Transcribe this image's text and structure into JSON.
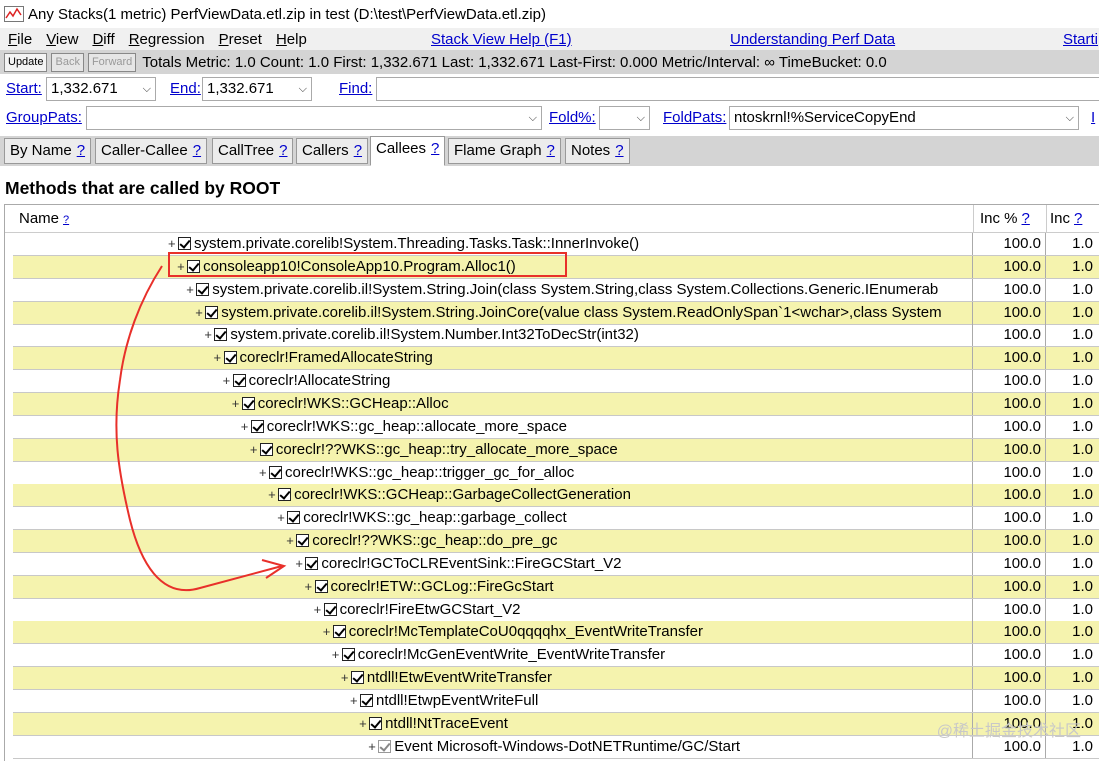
{
  "window": {
    "title": "Any Stacks(1 metric) PerfViewData.etl.zip in test (D:\\test\\PerfViewData.etl.zip)"
  },
  "menu": {
    "items": [
      {
        "u": "F",
        "rest": "ile"
      },
      {
        "u": "V",
        "rest": "iew"
      },
      {
        "u": "D",
        "rest": "iff"
      },
      {
        "u": "R",
        "rest": "egression"
      },
      {
        "u": "P",
        "rest": "reset"
      },
      {
        "u": "H",
        "rest": "elp"
      }
    ],
    "links": [
      "Stack View Help (F1)",
      "Understanding Perf Data",
      "Starti"
    ]
  },
  "status": {
    "update": "Update",
    "back": "Back",
    "forward": "Forward",
    "totals": "Totals Metric: 1.0  Count: 1.0  First: 1,332.671  Last: 1,332.671   Last-First: 0.000  Metric/Interval: ∞  TimeBucket: 0.0"
  },
  "range": {
    "start_label": "Start:",
    "start_value": "1,332.671",
    "end_label": "End:",
    "end_value": "1,332.671",
    "find_label": "Find:",
    "find_value": ""
  },
  "grouping": {
    "grouppats_label": "GroupPats:",
    "grouppats_value": "",
    "fold_label": "Fold%:",
    "fold_value": "",
    "foldpats_label": "FoldPats:",
    "foldpats_value": "ntoskrnl!%ServiceCopyEnd",
    "trailing_label": "I"
  },
  "tabs": [
    {
      "label": "By Name",
      "q": "?"
    },
    {
      "label": "Caller-Callee",
      "q": "?"
    },
    {
      "label": "CallTree",
      "q": "?"
    },
    {
      "label": "Callers",
      "q": "?"
    },
    {
      "label": "Callees",
      "q": "?"
    },
    {
      "label": "Flame Graph",
      "q": "?"
    },
    {
      "label": "Notes",
      "q": "?"
    }
  ],
  "heading": "Methods that are called by ROOT",
  "columns": {
    "name": "Name",
    "inc_pct": "Inc %",
    "inc": "Inc",
    "q": "?"
  },
  "rows": [
    {
      "name": "system.private.corelib!System.Threading.Tasks.Task::InnerInvoke()",
      "inc_pct": "100.0",
      "inc": "1.0"
    },
    {
      "name": "consoleapp10!ConsoleApp10.Program.Alloc1()",
      "inc_pct": "100.0",
      "inc": "1.0"
    },
    {
      "name": "system.private.corelib.il!System.String.Join(class System.String,class System.Collections.Generic.IEnumerab",
      "inc_pct": "100.0",
      "inc": "1.0"
    },
    {
      "name": "system.private.corelib.il!System.String.JoinCore(value class System.ReadOnlySpan`1<wchar>,class System",
      "inc_pct": "100.0",
      "inc": "1.0"
    },
    {
      "name": "system.private.corelib.il!System.Number.Int32ToDecStr(int32)",
      "inc_pct": "100.0",
      "inc": "1.0"
    },
    {
      "name": "coreclr!FramedAllocateString",
      "inc_pct": "100.0",
      "inc": "1.0"
    },
    {
      "name": "coreclr!AllocateString",
      "inc_pct": "100.0",
      "inc": "1.0"
    },
    {
      "name": "coreclr!WKS::GCHeap::Alloc",
      "inc_pct": "100.0",
      "inc": "1.0"
    },
    {
      "name": "coreclr!WKS::gc_heap::allocate_more_space",
      "inc_pct": "100.0",
      "inc": "1.0"
    },
    {
      "name": "coreclr!??WKS::gc_heap::try_allocate_more_space",
      "inc_pct": "100.0",
      "inc": "1.0"
    },
    {
      "name": "coreclr!WKS::gc_heap::trigger_gc_for_alloc",
      "inc_pct": "100.0",
      "inc": "1.0"
    },
    {
      "name": "coreclr!WKS::GCHeap::GarbageCollectGeneration",
      "inc_pct": "100.0",
      "inc": "1.0"
    },
    {
      "name": "coreclr!WKS::gc_heap::garbage_collect",
      "inc_pct": "100.0",
      "inc": "1.0"
    },
    {
      "name": "coreclr!??WKS::gc_heap::do_pre_gc",
      "inc_pct": "100.0",
      "inc": "1.0"
    },
    {
      "name": "coreclr!GCToCLREventSink::FireGCStart_V2",
      "inc_pct": "100.0",
      "inc": "1.0"
    },
    {
      "name": "coreclr!ETW::GCLog::FireGcStart",
      "inc_pct": "100.0",
      "inc": "1.0"
    },
    {
      "name": "coreclr!FireEtwGCStart_V2",
      "inc_pct": "100.0",
      "inc": "1.0"
    },
    {
      "name": "coreclr!McTemplateCoU0qqqqhx_EventWriteTransfer",
      "inc_pct": "100.0",
      "inc": "1.0"
    },
    {
      "name": "coreclr!McGenEventWrite_EventWriteTransfer",
      "inc_pct": "100.0",
      "inc": "1.0"
    },
    {
      "name": "ntdll!EtwEventWriteTransfer",
      "inc_pct": "100.0",
      "inc": "1.0"
    },
    {
      "name": "ntdll!EtwpEventWriteFull",
      "inc_pct": "100.0",
      "inc": "1.0"
    },
    {
      "name": "ntdll!NtTraceEvent",
      "inc_pct": "100.0",
      "inc": "1.0"
    },
    {
      "name": "Event Microsoft-Windows-DotNETRuntime/GC/Start",
      "inc_pct": "100.0",
      "inc": "1.0"
    }
  ],
  "watermark": "@稀土掘金技术社区",
  "colors": {
    "link": "#0000cc",
    "row_alt": "#f5f3ae",
    "annotation": "#e8302a",
    "toolbar": "#d4d4d4"
  }
}
